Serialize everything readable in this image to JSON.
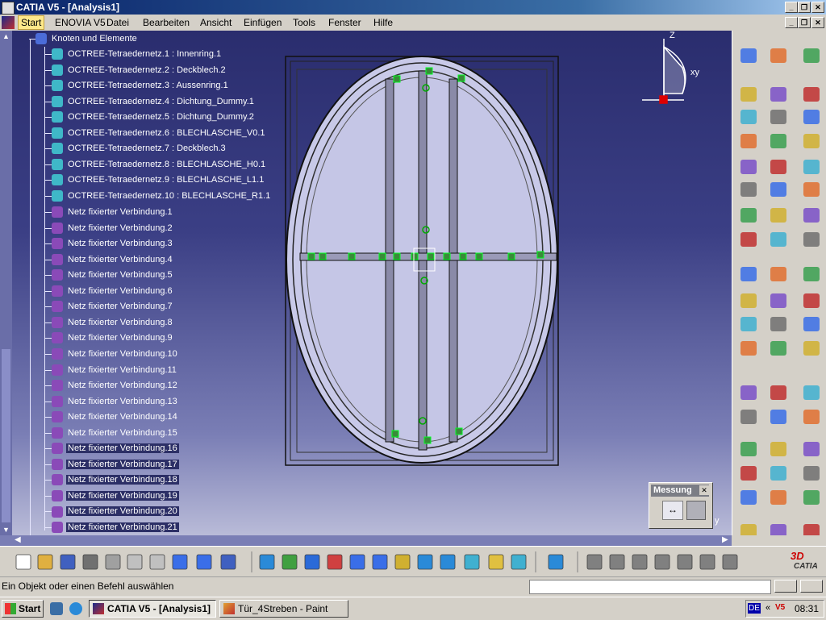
{
  "window": {
    "title": "CATIA V5 - [Analysis1]"
  },
  "menu": {
    "items": [
      "Start",
      "ENOVIA V5",
      "Datei",
      "Bearbeiten",
      "Ansicht",
      "Einfügen",
      "Tools",
      "Fenster",
      "Hilfe"
    ]
  },
  "tree": {
    "root": "Knoten und Elemente",
    "meshes": [
      "OCTREE-Tetraedernetz.1 : Innenring.1",
      "OCTREE-Tetraedernetz.2 : Deckblech.2",
      "OCTREE-Tetraedernetz.3 : Aussenring.1",
      "OCTREE-Tetraedernetz.4 : Dichtung_Dummy.1",
      "OCTREE-Tetraedernetz.5 : Dichtung_Dummy.2",
      "OCTREE-Tetraedernetz.6 : BLECHLASCHE_V0.1",
      "OCTREE-Tetraedernetz.7 : Deckblech.3",
      "OCTREE-Tetraedernetz.8 : BLECHLASCHE_H0.1",
      "OCTREE-Tetraedernetz.9 : BLECHLASCHE_L1.1",
      "OCTREE-Tetraedernetz.10 : BLECHLASCHE_R1.1"
    ],
    "connections": [
      "Netz fixierter Verbindung.1",
      "Netz fixierter Verbindung.2",
      "Netz fixierter Verbindung.3",
      "Netz fixierter Verbindung.4",
      "Netz fixierter Verbindung.5",
      "Netz fixierter Verbindung.6",
      "Netz fixierter Verbindung.7",
      "Netz fixierter Verbindung.8",
      "Netz fixierter Verbindung.9",
      "Netz fixierter Verbindung.10",
      "Netz fixierter Verbindung.11",
      "Netz fixierter Verbindung.12",
      "Netz fixierter Verbindung.13",
      "Netz fixierter Verbindung.14",
      "Netz fixierter Verbindung.15",
      "Netz fixierter Verbindung.16",
      "Netz fixierter Verbindung.17",
      "Netz fixierter Verbindung.18",
      "Netz fixierter Verbindung.19",
      "Netz fixierter Verbindung.20",
      "Netz fixierter Verbindung.21"
    ]
  },
  "compass": {
    "z_label": "Z",
    "xy_label": "xy"
  },
  "axis_corner_label": "y",
  "messung": {
    "title": "Messung",
    "close": "✕"
  },
  "status": {
    "message": "Ein Objekt oder einen Befehl auswählen"
  },
  "taskbar": {
    "start": "Start",
    "tasks": [
      "CATIA V5 - [Analysis1]",
      "Tür_4Streben - Paint"
    ],
    "lang": "DE",
    "clock": "08:31"
  },
  "brand": {
    "logo": "CATIA",
    "logo_prefix": "3D"
  },
  "colors": {
    "viewport_top": "#2a2d6e",
    "viewport_bottom": "#b9bbd8",
    "title_bar": "#0a246a"
  }
}
